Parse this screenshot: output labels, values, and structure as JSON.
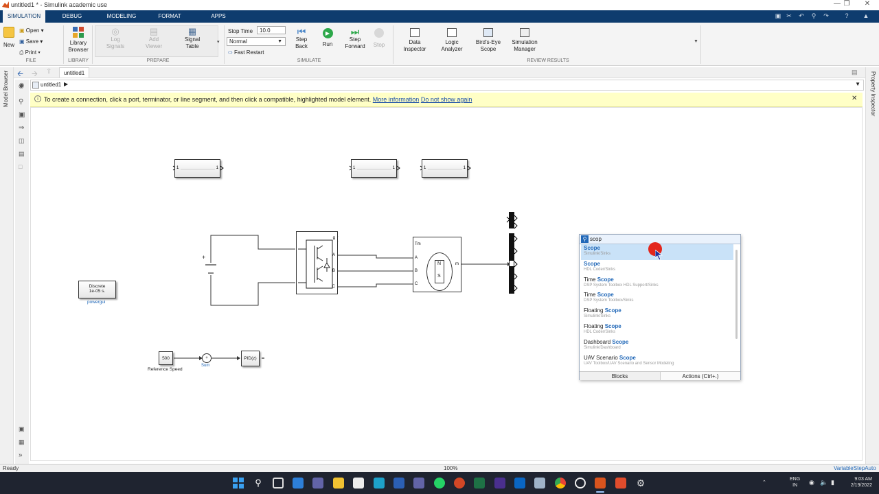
{
  "window": {
    "title": "untitled1 * - Simulink academic use"
  },
  "tabs": [
    "SIMULATION",
    "DEBUG",
    "MODELING",
    "FORMAT",
    "APPS"
  ],
  "ribbon": {
    "file": {
      "new": "New",
      "open": "Open",
      "save": "Save",
      "print": "Print",
      "caption": "FILE"
    },
    "library": {
      "label": "Library Browser",
      "caption": "LIBRARY"
    },
    "prepare": {
      "log_signals": "Log Signals",
      "add_viewer": "Add Viewer",
      "signal_table": "Signal Table",
      "caption": "PREPARE"
    },
    "simulate": {
      "stop_time_label": "Stop Time",
      "stop_time_value": "10.0",
      "mode_value": "Normal",
      "fast_restart": "Fast Restart",
      "step_back": "Step Back",
      "run": "Run",
      "step_forward": "Step Forward",
      "stop": "Stop",
      "caption": "SIMULATE"
    },
    "review": {
      "data_inspector": "Data Inspector",
      "logic_analyzer": "Logic Analyzer",
      "birds_eye": "Bird's-Eye Scope",
      "sim_manager": "Simulation Manager",
      "caption": "REVIEW RESULTS"
    }
  },
  "nav": {
    "tab_label": "untitled1",
    "address": "untitled1"
  },
  "infobar": {
    "message": "To create a connection, click a port, terminator, or line segment, and then click a compatible, highlighted model element.",
    "link_more": "More information",
    "link_hide": "Do not show again"
  },
  "side": {
    "left": "Model Browser",
    "right": "Property Inspector"
  },
  "model": {
    "powergui": {
      "line1": "Discrete",
      "line2": "1e-05 s.",
      "name": "powergui"
    },
    "constant": {
      "value": "500",
      "name": "Reference Speed"
    },
    "sum": {
      "name": "Sum"
    },
    "pid": {
      "label": "PID(z)"
    },
    "machine": {
      "n": "N",
      "s": "S",
      "tm": "Tm",
      "m": "m",
      "a": "A",
      "b": "B",
      "c": "C"
    },
    "converter": {
      "g": "g",
      "a": "A",
      "b": "B",
      "c": "C"
    },
    "port_one": "1"
  },
  "quick_insert": {
    "query": "scop",
    "results": [
      {
        "pre": "",
        "match": "Scope",
        "lib": "Simulink/Sinks"
      },
      {
        "pre": "",
        "match": "Scope",
        "lib": "HDL Coder/Sinks"
      },
      {
        "pre": "Time ",
        "match": "Scope",
        "lib": "DSP System Toolbox HDL Support/Sinks"
      },
      {
        "pre": "Time ",
        "match": "Scope",
        "lib": "DSP System Toolbox/Sinks"
      },
      {
        "pre": "Floating ",
        "match": "Scope",
        "lib": "Simulink/Sinks"
      },
      {
        "pre": "Floating ",
        "match": "Scope",
        "lib": "HDL Coder/Sinks"
      },
      {
        "pre": "Dashboard ",
        "match": "Scope",
        "lib": "Simulink/Dashboard"
      },
      {
        "pre": "UAV Scenario ",
        "match": "Scope",
        "lib": "UAV Toolbox/UAV Scenario and Sensor Modeling"
      }
    ],
    "tab_blocks": "Blocks",
    "tab_actions": "Actions (Ctrl+.)"
  },
  "status": {
    "left": "Ready",
    "zoom": "100%",
    "solver": "VariableStepAuto"
  },
  "taskbar": {
    "lang1": "ENG",
    "lang2": "IN",
    "time": "9:03 AM",
    "date": "2/19/2022"
  },
  "colors": {
    "tabstrip": "#0e3c6e",
    "accent": "#2168b8",
    "infobar": "#ffffc6",
    "cursor_dot": "#e3261c"
  }
}
